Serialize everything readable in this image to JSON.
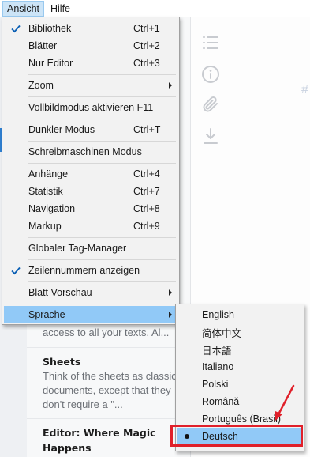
{
  "menubar": {
    "items": [
      {
        "label": "Ansicht"
      },
      {
        "label": "Hilfe"
      }
    ]
  },
  "view_menu": {
    "items": [
      {
        "label": "Bibliothek",
        "shortcut": "Ctrl+1",
        "checked": true
      },
      {
        "label": "Blätter",
        "shortcut": "Ctrl+2"
      },
      {
        "label": "Nur Editor",
        "shortcut": "Ctrl+3"
      },
      {
        "label": "Zoom",
        "submenu": true
      },
      {
        "label": "Vollbildmodus aktivieren F11"
      },
      {
        "label": "Dunkler Modus",
        "shortcut": "Ctrl+T"
      },
      {
        "label": "Schreibmaschinen Modus"
      },
      {
        "label": "Anhänge",
        "shortcut": "Ctrl+4"
      },
      {
        "label": "Statistik",
        "shortcut": "Ctrl+7"
      },
      {
        "label": "Navigation",
        "shortcut": "Ctrl+8"
      },
      {
        "label": "Markup",
        "shortcut": "Ctrl+9"
      },
      {
        "label": "Globaler Tag-Manager"
      },
      {
        "label": "Zeilennummern anzeigen",
        "checked": true
      },
      {
        "label": "Blatt Vorschau",
        "submenu": true
      },
      {
        "label": "Sprache",
        "submenu": true,
        "highlighted": true
      }
    ]
  },
  "language_menu": {
    "items": [
      {
        "label": "English"
      },
      {
        "label": "简体中文"
      },
      {
        "label": "日本語"
      },
      {
        "label": "Italiano"
      },
      {
        "label": "Polski"
      },
      {
        "label": "Română"
      },
      {
        "label": "Português (Brasil)"
      },
      {
        "label": "Deutsch",
        "selected": true
      }
    ]
  },
  "doc_list": {
    "items": [
      {
        "title": "",
        "desc": "access to all your texts. Al..."
      },
      {
        "title": "Sheets",
        "desc": "Think of the sheets as classic documents, except that they don't require a \"..."
      },
      {
        "title": "Editor: Where Magic Happens",
        "desc": ""
      }
    ]
  },
  "toolbar": {
    "icons": [
      "list-icon",
      "info-icon",
      "paperclip-icon",
      "download-icon"
    ],
    "hash_text": "#"
  },
  "colors": {
    "highlight": "#91c9f7",
    "menubar_open": "#cce4f7",
    "annotation": "#e0202a"
  }
}
